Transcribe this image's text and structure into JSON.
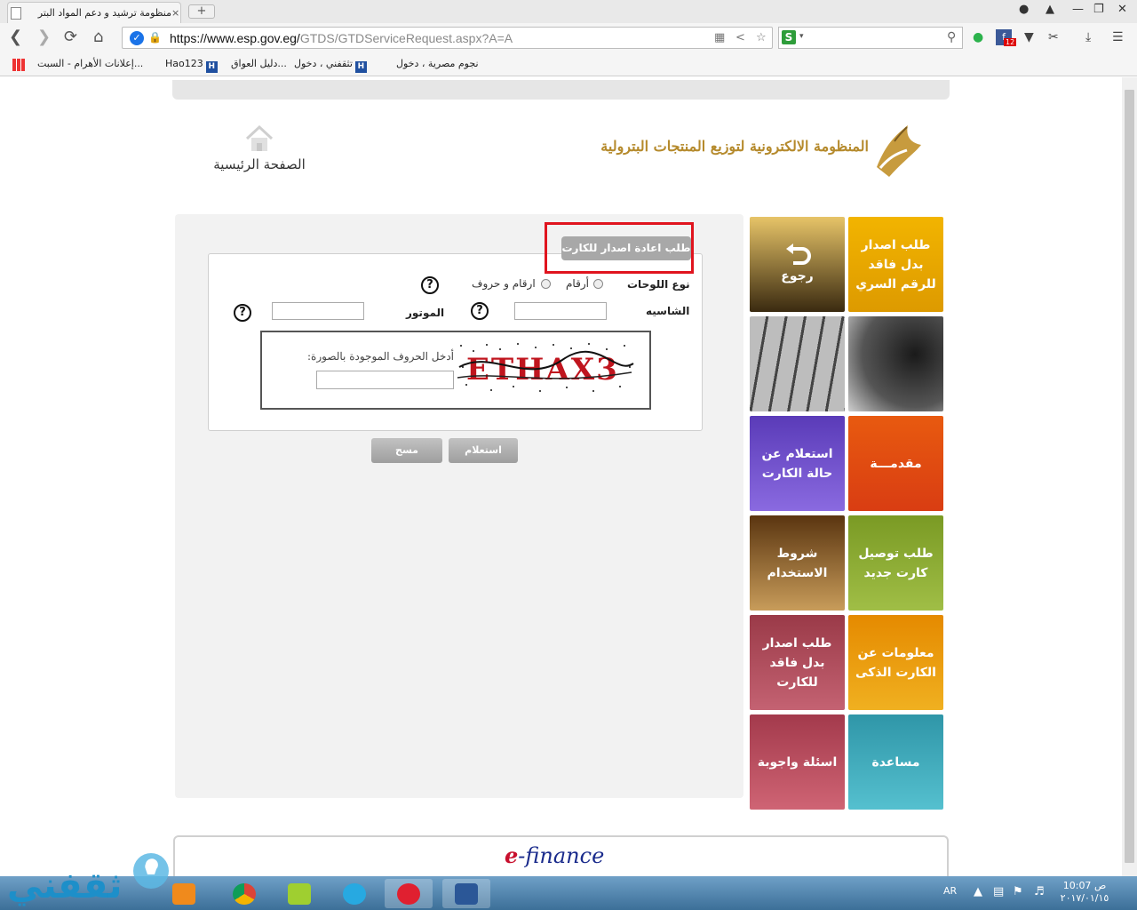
{
  "browser": {
    "tab_title": "منظومة ترشيد و دعم المواد البتر",
    "tab_close": "×",
    "new_tab": "+",
    "url_host": "https://www.esp.gov.eg/",
    "url_path": "GTDS/GTDServiceRequest.aspx?A=A",
    "ext_badge": "12",
    "bookmarks": [
      "نجوم مصرية ، دخول",
      "تثقفني ، دخول",
      "...دليل العواق",
      "Hao123",
      "...إعلانات الأهرام - السبت"
    ]
  },
  "header": {
    "logo_text": "المنظومة الالكترونية لتوزيع المنتجات البترولية",
    "home_label": "الصفحة الرئيسية"
  },
  "form": {
    "title": "طلب اعادة اصدار للكارت",
    "plate_type_label": "نوع اللوحات",
    "radio_numbers": "أرقام",
    "radio_numbers_letters": "ارقام و حروف",
    "chassis_label": "الشاسيه",
    "motor_label": "الموتور",
    "help_symbol": "?",
    "captcha_label": "أدخل الحروف الموجودة بالصورة:",
    "captcha_text": "ETHAX3",
    "inquiry_button": "استعلام",
    "clear_button": "مسح"
  },
  "tiles": {
    "lost_pin": "طلب اصدار بدل فاقد للرقم السري",
    "back": "رجوع",
    "intro": "مقدمـــة",
    "card_status": "استعلام عن حالة الكارت",
    "new_card_delivery": "طلب توصيل كارت جديد",
    "terms": "شروط الاستخدام",
    "smart_card_info": "معلومات عن الكارت الذكى",
    "lost_card": "طلب اصدار بدل فاقد للكارت",
    "help": "مساعدة",
    "faq": "اسئلة واجوبة"
  },
  "footer": {
    "brand_e": "e",
    "brand_rest": "-finance"
  },
  "taskbar": {
    "watermark": "ثقفني",
    "lang": "AR",
    "time": "10:07 ص",
    "date": "٢٠١٧/٠١/١٥",
    "apps": [
      "media-player",
      "chrome",
      "hao123",
      "video-player",
      "browser-s",
      "word"
    ]
  },
  "colors": {
    "highlight_red": "#e0141e",
    "tile_yellow": "#e8a500",
    "tile_orange": "#e45012",
    "tile_purple": "#6a4cc9",
    "tile_green": "#8aaa2c",
    "tile_brown": "#8a5a1e",
    "tile_gold": "#e59a00",
    "tile_rose": "#b04a5c",
    "tile_teal": "#3aa9b8"
  }
}
